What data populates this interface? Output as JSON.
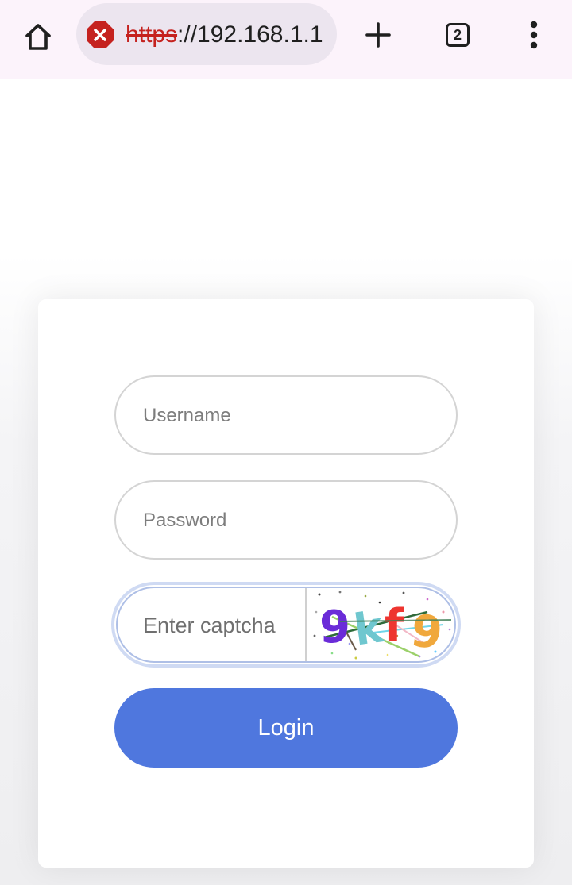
{
  "browser": {
    "url_scheme": "https",
    "url_rest": "://192.168.1.1",
    "tab_count": "2",
    "icons": {
      "home": "home-icon",
      "security": "not-secure-icon",
      "new_tab": "plus-icon",
      "tabs": "tab-switcher-icon",
      "menu": "more-vert-icon"
    },
    "colors": {
      "toolbar_bg": "#fcf3fb",
      "urlbar_bg": "#ece5ef",
      "insecure_red": "#c5221f"
    }
  },
  "login": {
    "username_placeholder": "Username",
    "password_placeholder": "Password",
    "captcha_placeholder": "Enter captcha",
    "captcha_text": "9kf9",
    "login_label": "Login",
    "colors": {
      "button_bg": "#4f77de",
      "focus_ring": "#cfdaf3",
      "field_border": "#d4d4d4"
    }
  }
}
